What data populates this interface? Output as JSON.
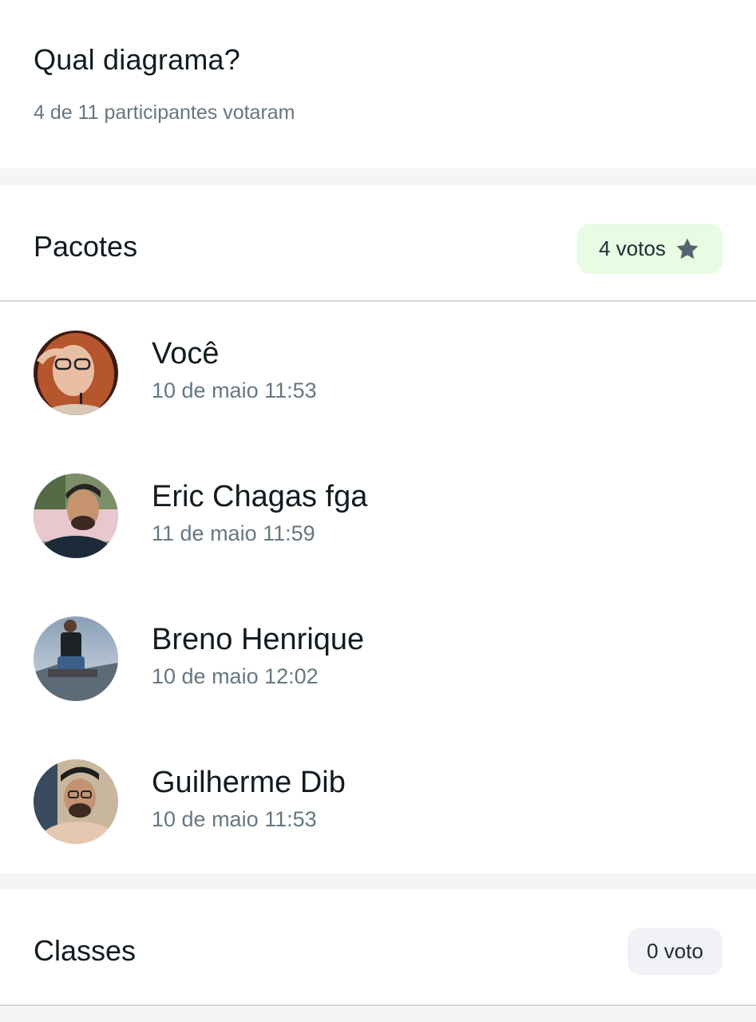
{
  "poll": {
    "title": "Qual diagrama?",
    "subtitle": "4 de 11 participantes votaram"
  },
  "options": [
    {
      "name": "Pacotes",
      "votes_label": "4 votos",
      "badge_icon": "star-icon",
      "voters": [
        {
          "name": "Você",
          "time": "10 de maio 11:53"
        },
        {
          "name": "Eric Chagas fga",
          "time": "11 de maio 11:59"
        },
        {
          "name": "Breno Henrique",
          "time": "10 de maio 12:02"
        },
        {
          "name": "Guilherme Dib",
          "time": "10 de maio 11:53"
        }
      ]
    },
    {
      "name": "Classes",
      "votes_label": "0 voto",
      "voters": []
    }
  ],
  "colors": {
    "winner_badge_bg": "#e7fce3",
    "neutral_badge_bg": "#f0f2f5",
    "secondary_text": "#667781",
    "primary_text": "#111b21"
  }
}
